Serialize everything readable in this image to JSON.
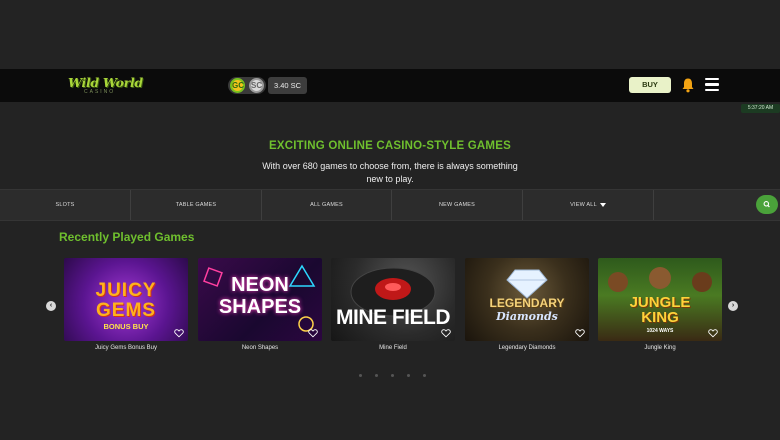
{
  "header": {
    "logo": {
      "text": "Wild World",
      "sub": "CASINO"
    },
    "coins": {
      "gc_icon": "gold-coin-icon",
      "sc_icon": "sweep-coin-icon",
      "gc_glyph": "GC",
      "sc_glyph": "SC"
    },
    "balance": "3.40 SC",
    "buy_label": "BUY",
    "bell_icon": "bell-icon",
    "menu_icon": "hamburger-menu-icon",
    "accent_color": "#6fbf2e"
  },
  "time_badge": "5:37:20 AM",
  "hero": {
    "title": "EXCITING ONLINE CASINO-STYLE GAMES",
    "subtitle": "With over 680 games to choose from, there is always something new to play."
  },
  "categories": [
    "SLOTS",
    "TABLE GAMES",
    "ALL GAMES",
    "NEW GAMES",
    "VIEW ALL"
  ],
  "recent": {
    "title": "Recently Played Games",
    "prev_icon": "chevron-left-icon",
    "next_icon": "chevron-right-icon",
    "games": [
      {
        "name": "Juicy Gems Bonus Buy",
        "art_line1": "JUICY",
        "art_line2": "GEMS",
        "art_line3": "BONUS BUY"
      },
      {
        "name": "Neon Shapes",
        "art_line1": "NEON",
        "art_line2": "SHAPES"
      },
      {
        "name": "Mine Field",
        "art_line1": "MINE FIELD"
      },
      {
        "name": "Legendary Diamonds",
        "art_line1": "LEGENDARY",
        "art_line2": "Diamonds"
      },
      {
        "name": "Jungle King",
        "art_line1": "JUNGLE",
        "art_line2": "KING",
        "art_line3": "1024 WAYS"
      }
    ]
  }
}
